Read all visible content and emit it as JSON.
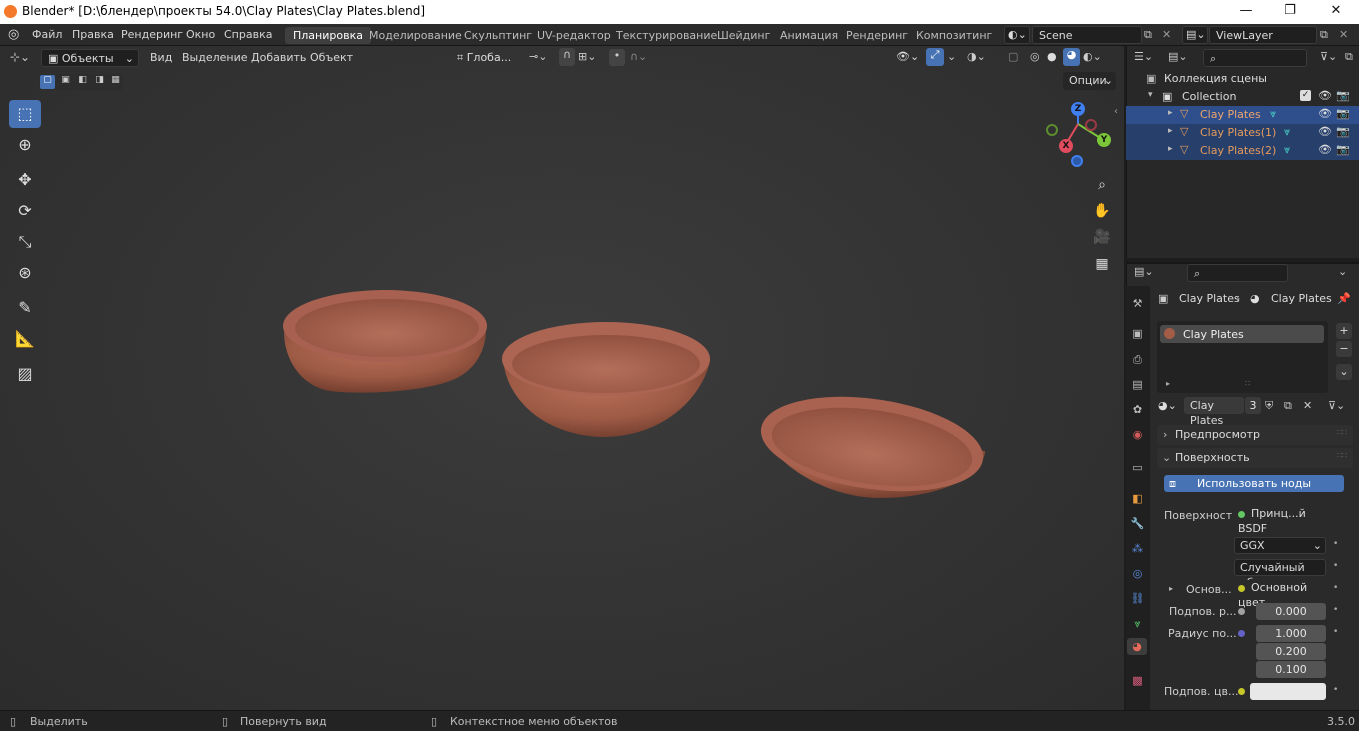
{
  "window": {
    "title": "Blender* [D:\\блендер\\проекты 54.0\\Clay Plates\\Clay Plates.blend]",
    "minimize": "—",
    "maximize": "❐",
    "close": "✕"
  },
  "topmenu": {
    "items": [
      "Файл",
      "Правка",
      "Рендеринг",
      "Окно",
      "Справка"
    ]
  },
  "workspaces": [
    "Планировка",
    "Моделирование",
    "Скульптинг",
    "UV-редактор",
    "Текстурирование",
    "Шейдинг",
    "Анимация",
    "Рендеринг",
    "Композитинг"
  ],
  "scene": {
    "name": "Scene",
    "view_layer": "ViewLayer"
  },
  "viewport": {
    "mode": "Объекты",
    "menus": [
      "Вид",
      "Выделение",
      "Добавить",
      "Объект"
    ],
    "orientation": "Глоба...",
    "options": "Опции",
    "gizmo": {
      "x": "X",
      "y": "Y",
      "z": "Z"
    }
  },
  "outliner": {
    "scene_collection": "Коллекция сцены",
    "collection": "Collection",
    "objects": [
      "Clay Plates",
      "Clay Plates(1)",
      "Clay Plates(2)"
    ]
  },
  "properties": {
    "breadcrumb": {
      "object": "Clay Plates",
      "material": "Clay Plates"
    },
    "slot": "Clay Plates",
    "material_name": "Clay Plates",
    "users": "3",
    "panels": {
      "preview": "Предпросмотр",
      "surface": "Поверхность"
    },
    "use_nodes": "Использовать ноды",
    "surface_label": "Поверхность",
    "surface_value": "Принц...й BSDF",
    "distribution": "GGX",
    "subsurface_method": "Случайный об...",
    "base_label": "Основ...",
    "base_value": "Основной цвет",
    "subsurface_label": "Подпов. р...",
    "subsurface_value": "0.000",
    "radius_label": "Радиус по...",
    "radius_values": [
      "1.000",
      "0.200",
      "0.100"
    ],
    "subsurface_color_label": "Подпов. цв..."
  },
  "status": {
    "select": "Выделить",
    "rotate": "Повернуть вид",
    "context": "Контекстное меню объектов",
    "version": "3.5.0"
  },
  "colors": {
    "accent": "#4772b3",
    "selected_row": "#2e4f8c",
    "object_text": "#e69b5c",
    "clay": "#a35c45"
  }
}
